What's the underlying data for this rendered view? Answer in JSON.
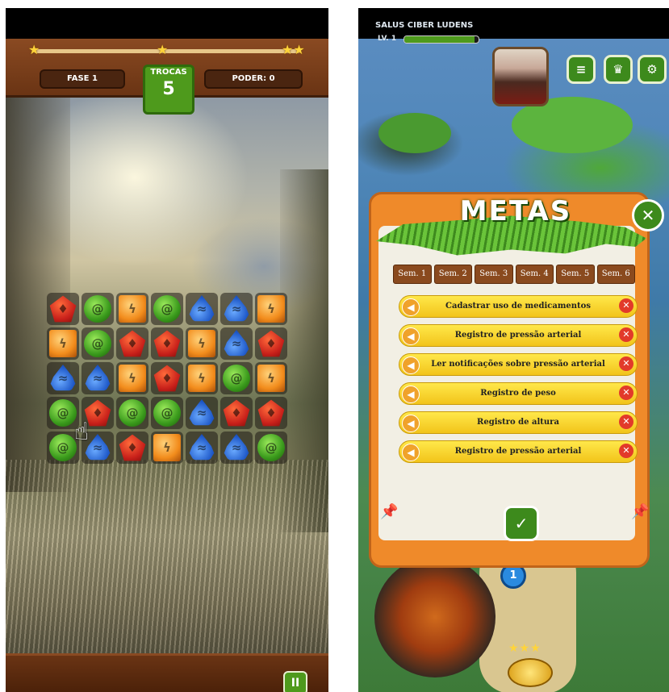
{
  "left_game": {
    "fase_label": "FASE 1",
    "trocas_label": "TROCAS",
    "trocas_value": "5",
    "poder_label": "PODER:",
    "poder_value": "0",
    "pause_label": "II",
    "board": [
      [
        "red",
        "green",
        "orange",
        "green",
        "blue",
        "blue",
        "orange"
      ],
      [
        "orange",
        "green",
        "red",
        "red",
        "orange",
        "blue",
        "red"
      ],
      [
        "blue",
        "blue",
        "orange",
        "red",
        "orange",
        "green",
        "orange"
      ],
      [
        "green",
        "red",
        "green",
        "green",
        "blue",
        "red",
        "red"
      ],
      [
        "green",
        "blue",
        "red",
        "orange",
        "blue",
        "blue",
        "green"
      ]
    ],
    "gem_symbols": {
      "red": "♦",
      "green": "@",
      "blue": "≈",
      "orange": "ϟ"
    },
    "colors": {
      "wood": "#7a3f1a",
      "green_button": "#4e9a1c"
    }
  },
  "right_game": {
    "player_name": "SALUS CIBER LUDENS",
    "level_label": "LV. 1",
    "xp_progress": 0.95,
    "menu_buttons": [
      {
        "name": "list-icon",
        "glyph": "≡"
      },
      {
        "name": "trophy-icon",
        "glyph": "♛"
      },
      {
        "name": "gear-icon",
        "glyph": "⚙"
      }
    ],
    "map_node": "1",
    "popup": {
      "title": "METAS",
      "close_glyph": "✕",
      "tabs": [
        "Sem. 1",
        "Sem. 2",
        "Sem. 3",
        "Sem. 4",
        "Sem. 5",
        "Sem. 6"
      ],
      "goals": [
        "Cadastrar uso de medicamentos",
        "Registro de pressão arterial",
        "Ler notificações sobre pressão arterial",
        "Registro de peso",
        "Registro de altura",
        "Registro de pressão arterial"
      ],
      "confirm_glyph": "✓"
    },
    "colors": {
      "panel": "#ef8a2a",
      "goal": "#f7d22a",
      "delete": "#e23a2a"
    }
  }
}
